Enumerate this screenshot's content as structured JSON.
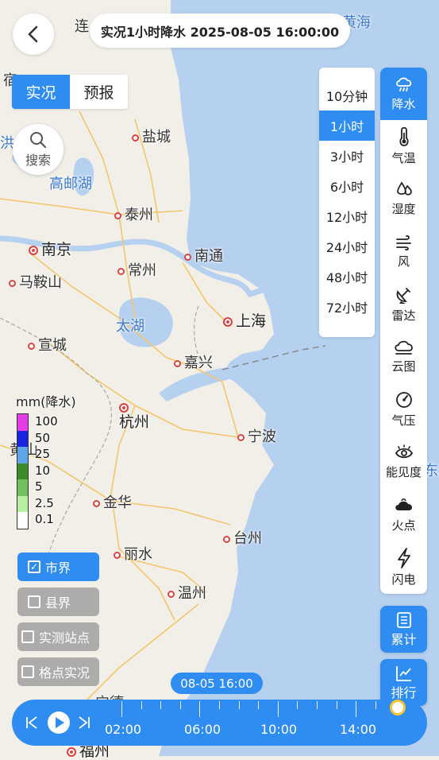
{
  "header": {
    "back_icon": "chevron-left-icon",
    "title": "实况1小时降水 2025-08-05 16:00:00"
  },
  "mode_tabs": [
    {
      "label": "实况",
      "active": true
    },
    {
      "label": "预报",
      "active": false
    }
  ],
  "search": {
    "label": "搜索",
    "icon": "search-icon"
  },
  "time_options": [
    {
      "label": "10分钟",
      "active": false
    },
    {
      "label": "1小时",
      "active": true
    },
    {
      "label": "3小时",
      "active": false
    },
    {
      "label": "6小时",
      "active": false
    },
    {
      "label": "12小时",
      "active": false
    },
    {
      "label": "24小时",
      "active": false
    },
    {
      "label": "48小时",
      "active": false
    },
    {
      "label": "72小时",
      "active": false
    }
  ],
  "layers": [
    {
      "label": "降水",
      "icon": "rain-cloud-icon",
      "active": true
    },
    {
      "label": "气温",
      "icon": "thermometer-icon",
      "active": false
    },
    {
      "label": "湿度",
      "icon": "droplets-icon",
      "active": false
    },
    {
      "label": "风",
      "icon": "wind-icon",
      "active": false
    },
    {
      "label": "雷达",
      "icon": "radar-dish-icon",
      "active": false
    },
    {
      "label": "云图",
      "icon": "cloud-icon",
      "active": false
    },
    {
      "label": "气压",
      "icon": "gauge-icon",
      "active": false
    },
    {
      "label": "能见度",
      "icon": "eye-icon",
      "active": false
    },
    {
      "label": "火点",
      "icon": "fire-cloud-icon",
      "active": false
    },
    {
      "label": "闪电",
      "icon": "lightning-icon",
      "active": false
    }
  ],
  "actions": {
    "cumulative": "累计",
    "ranking": "排行"
  },
  "legend": {
    "title": "mm(降水)",
    "levels": [
      "100",
      "50",
      "25",
      "10",
      "5",
      "2.5",
      "0.1"
    ],
    "colors": [
      "#e53be8",
      "#1a23e0",
      "#5fa6e8",
      "#3c8c2d",
      "#70c15c",
      "#b5ef9f",
      "#ffffff"
    ]
  },
  "boundaries": [
    {
      "label": "市界",
      "checked": true
    },
    {
      "label": "县界",
      "checked": false
    },
    {
      "label": "实测站点",
      "checked": false
    },
    {
      "label": "格点实况",
      "checked": false
    }
  ],
  "timeline": {
    "current": "08-05 16:00",
    "labels": [
      "02:00",
      "06:00",
      "10:00",
      "14:00"
    ],
    "icons": [
      "skip-back-icon",
      "play-icon",
      "skip-forward-icon"
    ]
  },
  "map": {
    "cities": [
      {
        "name": "连",
        "type": "edge"
      },
      {
        "name": "黄海",
        "type": "sea"
      },
      {
        "name": "宿",
        "type": "edge"
      },
      {
        "name": "洪",
        "type": "lake"
      },
      {
        "name": "盐城",
        "type": "city"
      },
      {
        "name": "高邮湖",
        "type": "lake"
      },
      {
        "name": "泰州",
        "type": "city"
      },
      {
        "name": "南京",
        "type": "capital"
      },
      {
        "name": "南通",
        "type": "city"
      },
      {
        "name": "常州",
        "type": "city"
      },
      {
        "name": "马鞍山",
        "type": "city"
      },
      {
        "name": "太湖",
        "type": "lake"
      },
      {
        "name": "上海",
        "type": "capital"
      },
      {
        "name": "宣城",
        "type": "city"
      },
      {
        "name": "嘉兴",
        "type": "city"
      },
      {
        "name": "杭州",
        "type": "capital"
      },
      {
        "name": "宁波",
        "type": "city"
      },
      {
        "name": "黄山",
        "type": "edge"
      },
      {
        "name": "金华",
        "type": "city"
      },
      {
        "name": "台州",
        "type": "city"
      },
      {
        "name": "丽水",
        "type": "city"
      },
      {
        "name": "温州",
        "type": "city"
      },
      {
        "name": "东海",
        "type": "sea"
      },
      {
        "name": "宁德",
        "type": "city"
      },
      {
        "name": "福州",
        "type": "capital"
      }
    ]
  }
}
